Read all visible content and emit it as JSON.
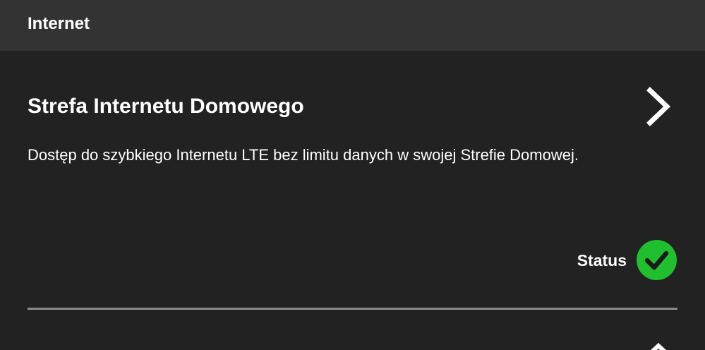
{
  "header": {
    "title": "Internet"
  },
  "service": {
    "title": "Strefa Internetu Domowego",
    "description": "Dostęp do szybkiego Internetu LTE bez limitu danych w swojej Strefie Domowej.",
    "status_label": "Status",
    "status_state": "active",
    "status_color": "#1fbf2e",
    "chevron_icon": "chevron-right-icon",
    "status_icon": "check-circle-icon"
  },
  "colors": {
    "background": "#222222",
    "header_background": "#333333",
    "divider": "#8a8a8a",
    "text": "#ffffff"
  }
}
